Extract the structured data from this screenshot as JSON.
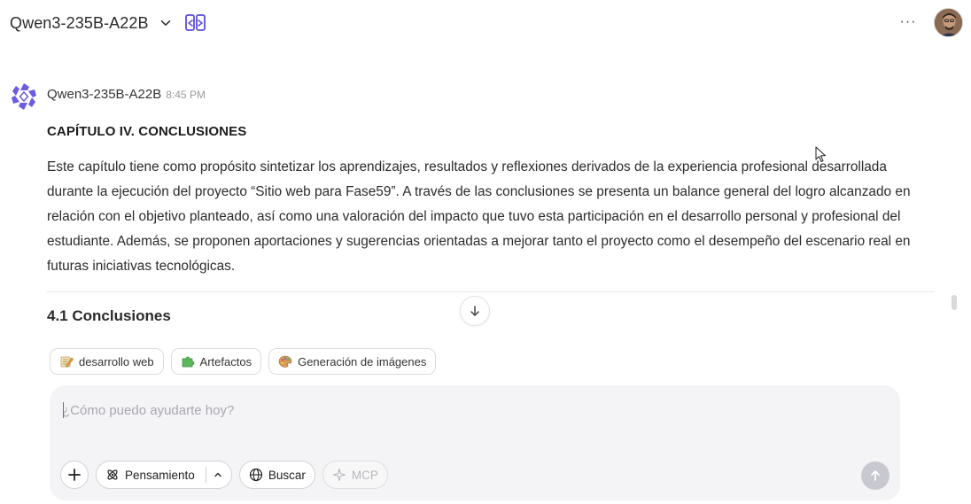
{
  "header": {
    "model_name": "Qwen3-235B-A22B",
    "more_label": "···"
  },
  "message": {
    "author": "Qwen3-235B-A22B",
    "time": "8:45 PM",
    "chapter_title": "CAPÍTULO IV. CONCLUSIONES",
    "paragraph": "Este capítulo tiene como propósito sintetizar los aprendizajes, resultados y reflexiones derivados de la experiencia profesional desarrollada durante la ejecución del proyecto “Sitio web para Fase59”. A través de las conclusiones se presenta un balance general del logro alcanzado en relación con el objetivo planteado, así como una valoración del impacto que tuvo esta participación en el desarrollo personal y profesional del estudiante. Además, se proponen aportaciones y sugerencias orientadas a mejorar tanto el proyecto como el desempeño del escenario real en futuras iniciativas tecnológicas.",
    "section_title": "4.1 Conclusiones"
  },
  "suggestions": [
    {
      "label": "desarrollo web",
      "icon": "memo-pencil-icon"
    },
    {
      "label": "Artefactos",
      "icon": "puzzle-icon"
    },
    {
      "label": "Generación de imágenes",
      "icon": "palette-icon"
    }
  ],
  "composer": {
    "placeholder": "¿Cómo puedo ayudarte hoy?",
    "value": "",
    "thinking_label": "Pensamiento",
    "search_label": "Buscar",
    "mcp_label": "MCP"
  },
  "colors": {
    "accent": "#6c5ce7",
    "compare_icon": "#5b4fd6",
    "logo": "#6b5ce0",
    "send_disabled": "#c8c8d0"
  }
}
